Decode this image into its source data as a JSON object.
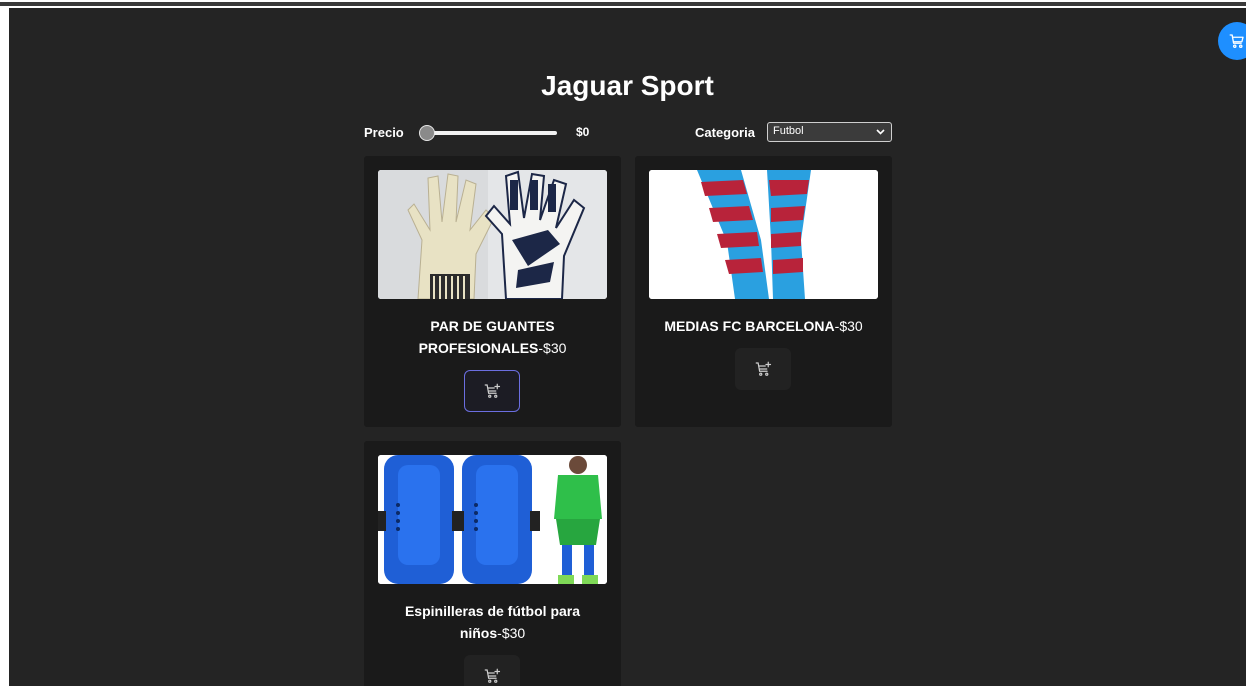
{
  "app": {
    "title": "Jaguar Sport",
    "cart_icon": "cart-icon"
  },
  "filters": {
    "price_label": "Precio",
    "price_value": "$0",
    "price_slider_level": 0,
    "category_label": "Categoria",
    "category_selected": "Futbol"
  },
  "products": [
    {
      "name": "PAR DE GUANTES PROFESIONALES",
      "price": "-$30",
      "image": "goalkeeper-gloves-image",
      "add_icon": "add-to-cart-icon"
    },
    {
      "name": "MEDIAS FC BARCELONA",
      "price": "-$30",
      "image": "barcelona-socks-image",
      "add_icon": "add-to-cart-icon"
    },
    {
      "name": "Espinilleras de fútbol para niños",
      "price": "-$30",
      "image": "shin-guards-image",
      "add_icon": "add-to-cart-icon"
    }
  ],
  "colors": {
    "background": "#242424",
    "card": "#1a1a1a",
    "accent": "#1e8fff",
    "focus_border": "#6b6ee0"
  }
}
